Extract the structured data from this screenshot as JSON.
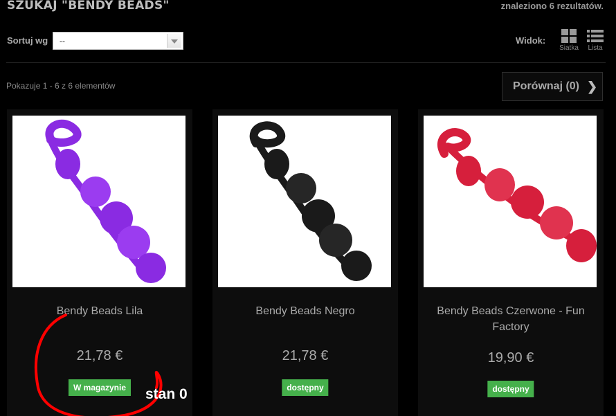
{
  "header": {
    "title": "SZUKAJ  \"BENDY BEADS\"",
    "result_count": "znaleziono 6 rezultatów."
  },
  "sort": {
    "label": "Sortuj wg",
    "selected": "--"
  },
  "view": {
    "label": "Widok:",
    "grid_label": "Siatka",
    "list_label": "Lista"
  },
  "showing": "Pokazuje 1 - 6 z 6 elementów",
  "compare": {
    "label": "Porównaj (0)"
  },
  "products": [
    {
      "name": "Bendy Beads Lila",
      "price": "21,78 €",
      "availability": "W magazynie",
      "color": "#8a2be2"
    },
    {
      "name": "Bendy Beads Negro",
      "price": "21,78 €",
      "availability": "dostępny",
      "color": "#1a1a1a"
    },
    {
      "name": "Bendy Beads Czerwone - Fun Factory",
      "price": "19,90 €",
      "availability": "dostępny",
      "color": "#d61f3c"
    }
  ],
  "annotation": {
    "text": "stan 0",
    "color": "#ff0000"
  },
  "colors": {
    "background": "#000000",
    "badge_green": "#45b04b"
  }
}
